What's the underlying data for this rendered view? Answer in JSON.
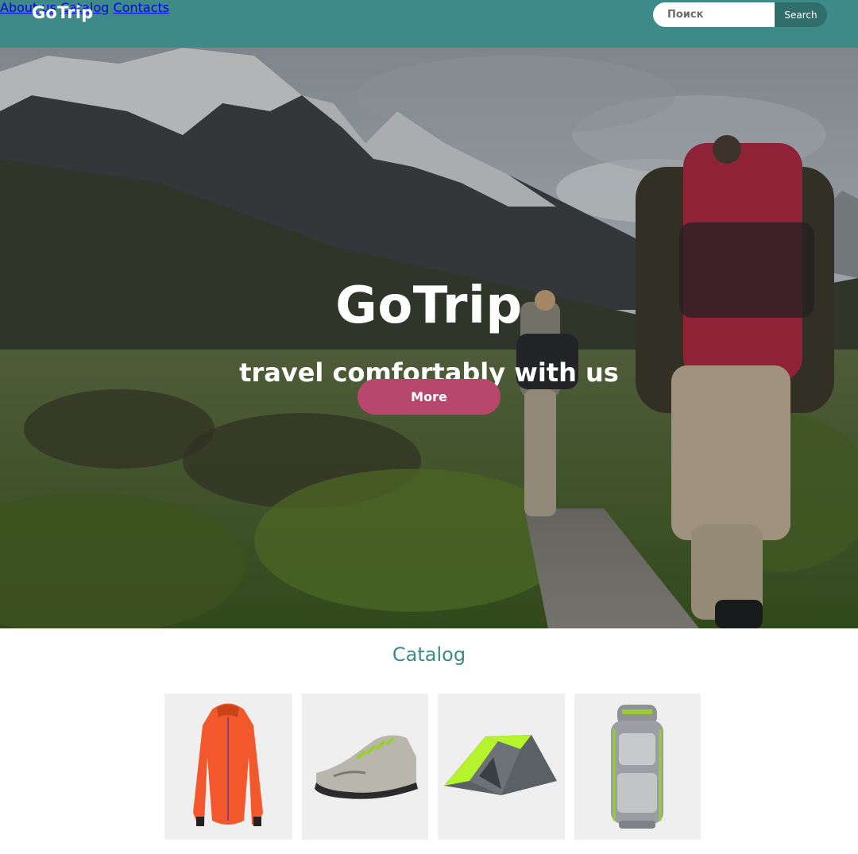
{
  "header": {
    "logo": "GoTrip",
    "nav": [
      {
        "label": "About us"
      },
      {
        "label": "Catalog"
      },
      {
        "label": "Contacts"
      }
    ],
    "search": {
      "placeholder": "Поиск",
      "button_label": "Search"
    }
  },
  "hero": {
    "title": "GoTrip",
    "subtitle": "travel comfortably with us",
    "button_label": "More"
  },
  "catalog": {
    "title": "Catalog",
    "items": [
      {
        "name": "jacket",
        "color": "#f2582c"
      },
      {
        "name": "shoe",
        "color": "#9acd32"
      },
      {
        "name": "tent",
        "color": "#b5f42c"
      },
      {
        "name": "backpack",
        "color": "#9b9ea2"
      }
    ]
  },
  "colors": {
    "header_bg": "#3d8a88",
    "search_button": "#2f6e6b",
    "accent_button": "#b8476e",
    "catalog_title": "#3d8a88",
    "card_bg": "#efefef"
  }
}
